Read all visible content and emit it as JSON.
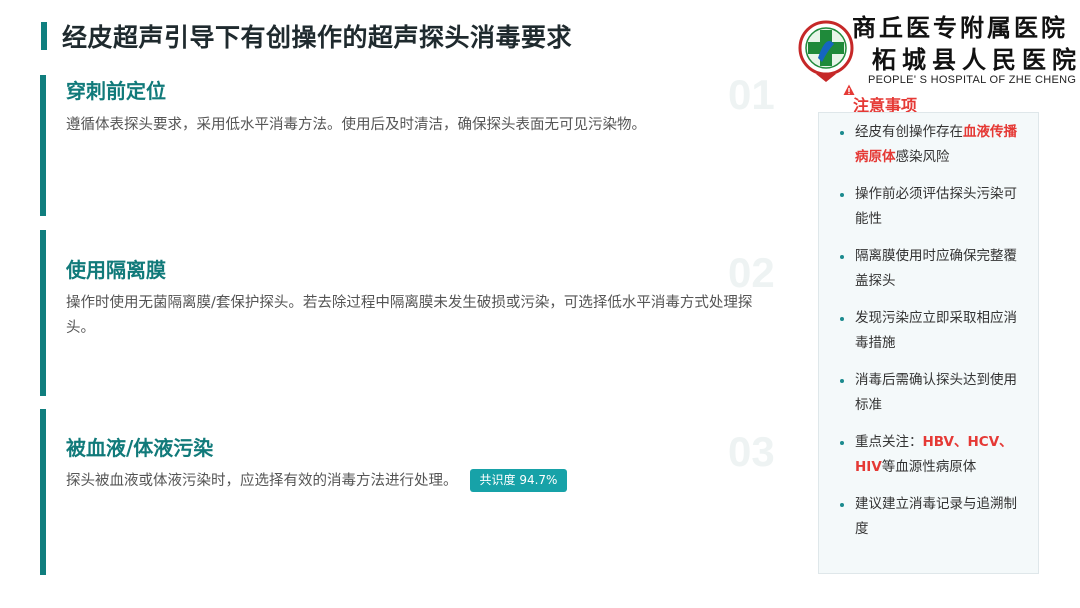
{
  "title": "经皮超声引导下有创操作的超声探头消毒要求",
  "logo": {
    "name_line1": "商丘医专附属医院",
    "name_line2": "柘城县人民医院",
    "name_en": "PEOPLE' S HOSPITAL OF ZHE CHENG",
    "colors": {
      "green": "#1f8a3a",
      "red": "#c62828",
      "blue": "#1565c0"
    }
  },
  "sections": [
    {
      "number": "01",
      "heading": "穿刺前定位",
      "body": "遵循体表探头要求，采用低水平消毒方法。使用后及时清洁，确保探头表面无可见污染物。"
    },
    {
      "number": "02",
      "heading": "使用隔离膜",
      "body": "操作时使用无菌隔离膜/套保护探头。若去除过程中隔离膜未发生破损或污染，可选择低水平消毒方式处理探头。"
    },
    {
      "number": "03",
      "heading": "被血液/体液污染",
      "body": "探头被血液或体液污染时，应选择有效的消毒方法进行处理。",
      "badge": "共识度 94.7%"
    }
  ],
  "notes": {
    "title": "注意事项",
    "items": [
      {
        "pre": "经皮有创操作存在",
        "hl": "血液传播病原体",
        "post": "感染风险"
      },
      {
        "pre": "操作前必须评估探头污染可能性",
        "hl": "",
        "post": ""
      },
      {
        "pre": "隔离膜使用时应确保完整覆盖探头",
        "hl": "",
        "post": ""
      },
      {
        "pre": "发现污染应立即采取相应消毒措施",
        "hl": "",
        "post": ""
      },
      {
        "pre": "消毒后需确认探头达到使用标准",
        "hl": "",
        "post": ""
      },
      {
        "pre": "重点关注：",
        "hl": "HBV、HCV、HIV",
        "post": "等血源性病原体"
      },
      {
        "pre": "建议建立消毒记录与追溯制度",
        "hl": "",
        "post": ""
      }
    ]
  },
  "colors": {
    "accent": "#107e7e",
    "heading": "#117a7a",
    "highlight": "#e53935",
    "badge": "#17a2a8"
  }
}
